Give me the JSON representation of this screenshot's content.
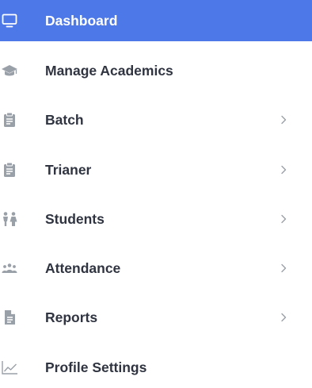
{
  "sidebar": {
    "items": [
      {
        "label": "Dashboard",
        "icon": "monitor-icon",
        "active": true,
        "has_submenu": false
      },
      {
        "label": "Manage Academics",
        "icon": "graduation-cap-icon",
        "active": false,
        "has_submenu": false
      },
      {
        "label": "Batch",
        "icon": "clipboard-icon",
        "active": false,
        "has_submenu": true
      },
      {
        "label": "Trianer",
        "icon": "clipboard-icon",
        "active": false,
        "has_submenu": true
      },
      {
        "label": "Students",
        "icon": "people-icon",
        "active": false,
        "has_submenu": true
      },
      {
        "label": "Attendance",
        "icon": "users-group-icon",
        "active": false,
        "has_submenu": true
      },
      {
        "label": "Reports",
        "icon": "document-icon",
        "active": false,
        "has_submenu": true
      },
      {
        "label": "Profile Settings",
        "icon": "chart-line-icon",
        "active": false,
        "has_submenu": false
      }
    ]
  },
  "colors": {
    "active_background": "#4c78e8",
    "active_text": "#ffffff",
    "text": "#2f3440",
    "icon": "#9aa0a8",
    "chevron": "#9aa0a8"
  }
}
